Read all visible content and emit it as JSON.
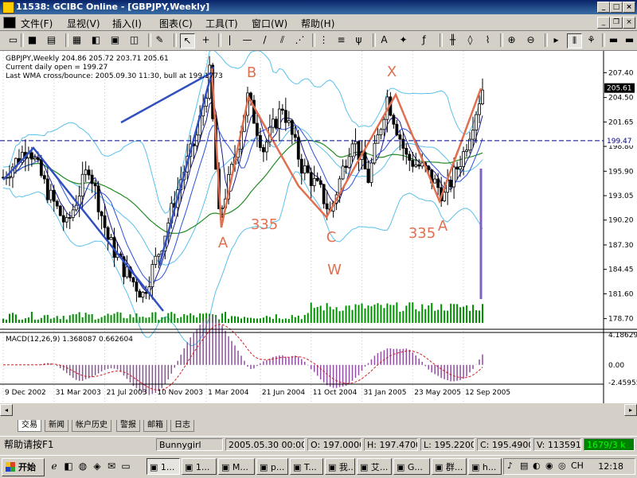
{
  "window": {
    "title": "11538: GCIBC Online - [GBPJPY,Weekly]",
    "min_label": "_",
    "max_label": "□",
    "close_label": "×"
  },
  "menu": {
    "items": [
      "文件(F)",
      "显视(V)",
      "插入(I)",
      "图表(C)",
      "工具(T)",
      "窗口(W)",
      "帮助(H)"
    ]
  },
  "toolbar": {
    "buttons": [
      {
        "name": "new-chart-icon",
        "glyph": "▭"
      },
      {
        "name": "save-icon",
        "glyph": "■"
      },
      {
        "name": "print-icon",
        "glyph": "▤"
      },
      {
        "name": "market-watch-icon",
        "glyph": "▦"
      },
      {
        "name": "navigator-icon",
        "glyph": "◧"
      },
      {
        "name": "terminal-icon",
        "glyph": "▣"
      },
      {
        "name": "tester-icon",
        "glyph": "◫"
      },
      {
        "name": "pencil-icon",
        "glyph": "✎"
      },
      {
        "name": "cursor-icon",
        "glyph": "↖"
      },
      {
        "name": "crosshair-icon",
        "glyph": "+"
      },
      {
        "name": "vertical-line-icon",
        "glyph": "|"
      },
      {
        "name": "horizontal-line-icon",
        "glyph": "—"
      },
      {
        "name": "trendline-icon",
        "glyph": "/"
      },
      {
        "name": "channel-icon",
        "glyph": "⫽"
      },
      {
        "name": "gann-fan-icon",
        "glyph": "⋰"
      },
      {
        "name": "fibonacci-icon",
        "glyph": "⋮"
      },
      {
        "name": "fibo-lines-icon",
        "glyph": "≡"
      },
      {
        "name": "andrews-pitchfork-icon",
        "glyph": "ψ"
      },
      {
        "name": "text-icon",
        "glyph": "A"
      },
      {
        "name": "label-icon",
        "glyph": "✦"
      },
      {
        "name": "period-icon",
        "glyph": "ƒ"
      },
      {
        "name": "bar-chart-icon",
        "glyph": "╫"
      },
      {
        "name": "candles-icon",
        "glyph": "◊"
      },
      {
        "name": "line-chart-icon",
        "glyph": "⌇"
      },
      {
        "name": "zoom-in-icon",
        "glyph": "⊕"
      },
      {
        "name": "zoom-out-icon",
        "glyph": "⊖"
      },
      {
        "name": "autoscroll-icon",
        "glyph": "▸"
      },
      {
        "name": "chart-shift-icon",
        "glyph": "⦀"
      },
      {
        "name": "indicators-icon",
        "glyph": "⚘"
      },
      {
        "name": "periodicity-icon",
        "glyph": "▬"
      },
      {
        "name": "templates-icon",
        "glyph": "▬"
      }
    ]
  },
  "chart_header": {
    "line1": "GBPJPY,Weekly  204.86 205.72 203.71 205.61",
    "line2": "Current daily open = 199.27",
    "line3": "Last WMA cross/bounce: 2005.09.30 11:30, bull at 199.1773"
  },
  "macd_header": {
    "label": "MACD(12,26,9)  1.368087  0.662604"
  },
  "price_labels": {
    "current": "205.61",
    "daily_open": "199.47"
  },
  "annotations": [
    "B",
    "X",
    "A",
    "335",
    "C",
    "335",
    "A",
    "W"
  ],
  "chart_data": {
    "type": "candlestick",
    "symbol": "GBPJPY",
    "period": "Weekly",
    "price_ticks": [
      207.4,
      204.5,
      201.65,
      198.8,
      195.9,
      193.05,
      190.2,
      187.3,
      184.45,
      181.6,
      178.7
    ],
    "price_tick_labels": [
      "207.40",
      "204.50",
      "201.65",
      "198.80",
      "195.90",
      "193.05",
      "190.20",
      "187.30",
      "184.45",
      "181.60",
      "178.70"
    ],
    "ylim": [
      178.2,
      209.2
    ],
    "macd_ticks": [
      "4.18629",
      "0.00",
      "-2.45955"
    ],
    "macd_ylim": [
      -2.45955,
      4.18629
    ],
    "x_ticks": [
      "9 Dec 2002",
      "31 Mar 2003",
      "21 Jul 2003",
      "10 Nov 2003",
      "1 Mar 2004",
      "21 Jun 2004",
      "11 Oct 2004",
      "31 Jan 2005",
      "23 May 2005",
      "12 Sep 2005"
    ],
    "bar_count": 152,
    "price_path": [
      [
        0,
        195.2
      ],
      [
        8,
        198.9
      ],
      [
        14,
        193.5
      ],
      [
        20,
        189.5
      ],
      [
        27,
        196.5
      ],
      [
        33,
        188
      ],
      [
        38,
        184.5
      ],
      [
        44,
        181.5
      ],
      [
        50,
        187.5
      ],
      [
        56,
        195
      ],
      [
        61,
        200
      ],
      [
        65,
        207.2
      ],
      [
        68,
        190.5
      ],
      [
        72,
        196
      ],
      [
        77,
        204.5
      ],
      [
        82,
        198.5
      ],
      [
        88,
        203.5
      ],
      [
        94,
        196.5
      ],
      [
        100,
        193.5
      ],
      [
        103,
        191
      ],
      [
        110,
        200
      ],
      [
        115,
        195
      ],
      [
        121,
        204.5
      ],
      [
        127,
        197.5
      ],
      [
        133,
        196
      ],
      [
        139,
        193
      ],
      [
        145,
        198
      ],
      [
        151,
        205.6
      ]
    ],
    "open": {
      "value": 199.47
    },
    "status": {
      "user": "Bunnygirl",
      "time": "2005.05.30 00:00",
      "O": "197.0000",
      "H": "197.4700",
      "L": "195.2200",
      "C": "195.4900",
      "V": "113591"
    }
  },
  "tabs": [
    "交易",
    "新闻",
    "帐户历史",
    "警报",
    "邮箱",
    "日志"
  ],
  "statusbar": {
    "help": "帮助请按F1",
    "user": "Bunnygirl",
    "time": "2005.05.30 00:00",
    "open": "O: 197.0000",
    "high": "H: 197.4700",
    "low": "L: 195.2200",
    "close": "C: 195.4900",
    "volume": "V: 113591",
    "traffic": "1679/3 k"
  },
  "taskbar": {
    "start": "开始",
    "tasks": [
      "1...",
      "1...",
      "M...",
      "p...",
      "T...",
      "我...",
      "艾...",
      "G...",
      "群...",
      "h..."
    ],
    "clock": "12:18",
    "lang": "CH"
  },
  "colors": {
    "bull_candle": "#006400",
    "bear_candle": "#003000",
    "bollinger": "#5bc0eb",
    "wma_fast": "#1a1a8c",
    "ma_slow": "#228b22",
    "trend_blue": "#3050c0",
    "wave_orange": "#e07050",
    "status_green": "#00ff00"
  }
}
